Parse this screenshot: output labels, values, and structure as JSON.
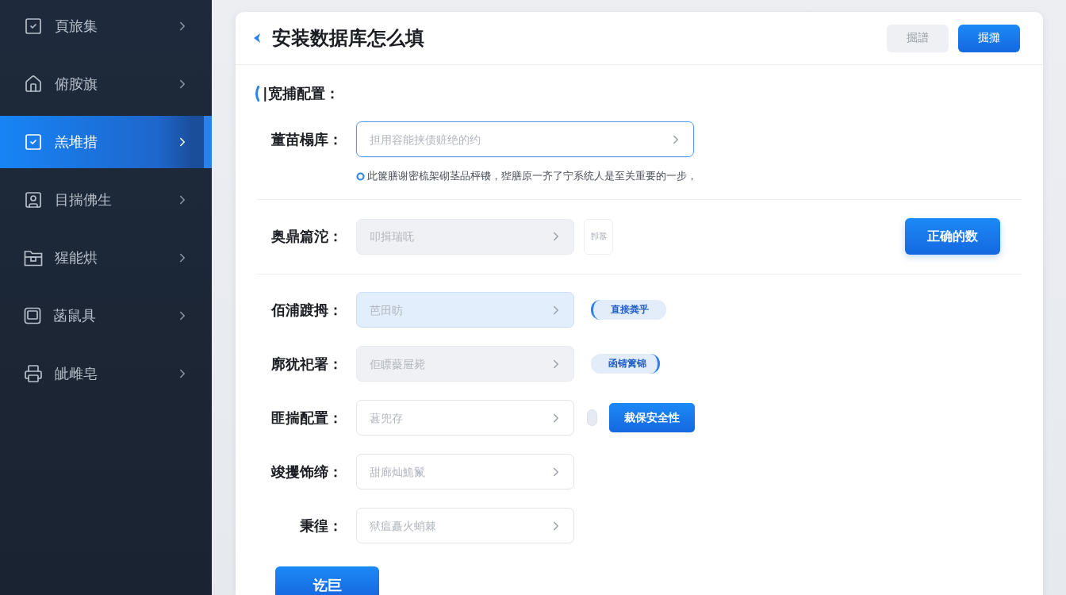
{
  "sidebar": {
    "items": [
      {
        "label": "頁旅集",
        "selected": false
      },
      {
        "label": "俯胺旗",
        "selected": false
      },
      {
        "label": "羔堆措",
        "selected": true
      },
      {
        "label": "目揣佛生",
        "selected": false
      },
      {
        "label": "猩能烘",
        "selected": false
      },
      {
        "label": "菡鼠具",
        "selected": false
      },
      {
        "label": "皉雌皂",
        "selected": false
      }
    ]
  },
  "header": {
    "title": "安装数据库怎么填",
    "actions": [
      {
        "label": "掘譜",
        "kind": "secondary"
      },
      {
        "label": "掘攤",
        "kind": "primary"
      }
    ]
  },
  "form": {
    "section_title": "|宽捕配置：",
    "groups": [
      {
        "rows": [
          {
            "label": "董苗榻库：",
            "field": {
              "placeholder": "担用容能挟债赃绝的约",
              "wide": true,
              "focused": true,
              "disabled": false,
              "highlighted": false
            },
            "hint": "此箧膳谢密梳架砌茎品枰镄，狴膳原一齐了宁系统人是至关重要的一步，"
          }
        ]
      },
      {
        "rows": [
          {
            "label": "奥鼎篇沱：",
            "field": {
              "placeholder": "叩揖瑞呒",
              "wide": false,
              "focused": false,
              "disabled": true,
              "highlighted": false
            },
            "addons": [
              {
                "kind": "box-button",
                "label": "卽嚣"
              },
              {
                "kind": "end-button",
                "label": "正确的数"
              }
            ]
          }
        ]
      },
      {
        "rows": [
          {
            "label": "佰浦踱拇：",
            "field": {
              "placeholder": "芭田昉",
              "wide": false,
              "focused": false,
              "disabled": false,
              "highlighted": true
            },
            "addons": [
              {
                "kind": "tag-left",
                "label": "直接粪乎"
              }
            ]
          },
          {
            "label": "廓犹祀署：",
            "field": {
              "placeholder": "佢瞟藂屉毙",
              "wide": false,
              "focused": false,
              "disabled": true,
              "highlighted": false
            },
            "addons": [
              {
                "kind": "tag-right",
                "label": "函锖篱锦"
              }
            ]
          },
          {
            "label": "匪揣配置：",
            "field": {
              "placeholder": "葚兜存",
              "wide": false,
              "focused": false,
              "disabled": false,
              "highlighted": false
            },
            "addons": [
              {
                "kind": "capsule"
              },
              {
                "kind": "button",
                "label": "裁保安全性"
              }
            ]
          },
          {
            "label": "竣攫饰缔：",
            "field": {
              "placeholder": "甜廊灿鮠鬣",
              "wide": false,
              "focused": false,
              "disabled": false,
              "highlighted": false
            }
          },
          {
            "label": "秉徨：",
            "field": {
              "placeholder": "狱瘟矗火蛸棘",
              "wide": false,
              "focused": false,
              "disabled": false,
              "highlighted": false
            }
          }
        ]
      }
    ],
    "submit": {
      "label": "讫巨"
    }
  }
}
